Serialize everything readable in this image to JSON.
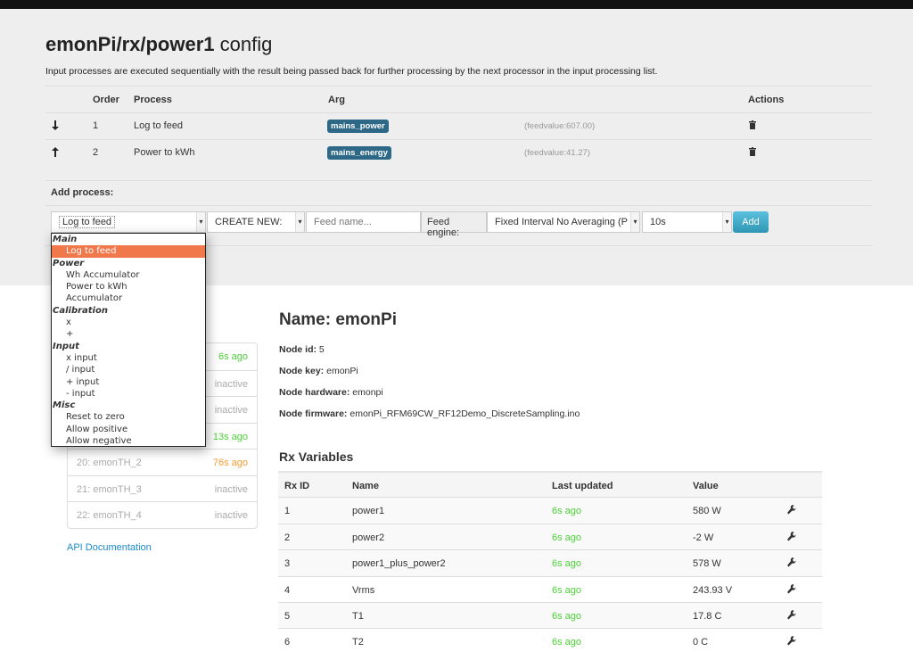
{
  "header": {
    "title_bold": "emonPi/rx/power1",
    "title_rest": " config",
    "description": "Input processes are executed sequentially with the result being passed back for further processing by the next processor in the input processing list."
  },
  "process_table": {
    "headers": {
      "order": "Order",
      "process": "Process",
      "arg": "Arg",
      "actions": "Actions"
    },
    "rows": [
      {
        "move_icon": "arrow-down-icon",
        "order": "1",
        "process": "Log to feed",
        "arg": "mains_power",
        "feedvalue": "(feedvalue:607.00)"
      },
      {
        "move_icon": "arrow-up-icon",
        "order": "2",
        "process": "Power to kWh",
        "arg": "mains_energy",
        "feedvalue": "(feedvalue:41.27)"
      }
    ]
  },
  "add_process": {
    "label": "Add process:",
    "process_select": "Log to feed",
    "create_select": "CREATE NEW:",
    "feed_name_placeholder": "Feed name...",
    "feed_engine_label": "Feed engine:",
    "feed_engine_select": "Fixed Interval No Averaging (P",
    "interval_select": "10s",
    "add_button": "Add"
  },
  "dropdown": {
    "groups": [
      {
        "label": "Main",
        "options": [
          "Log to feed"
        ]
      },
      {
        "label": "Power",
        "options": [
          "Wh Accumulator",
          "Power to kWh",
          "Accumulator"
        ]
      },
      {
        "label": "Calibration",
        "options": [
          "x",
          "+"
        ]
      },
      {
        "label": "Input",
        "options": [
          "x input",
          "/ input",
          "+ input",
          "- input"
        ]
      },
      {
        "label": "Misc",
        "options": [
          "Reset to zero",
          "Allow positive",
          "Allow negative"
        ]
      }
    ],
    "selected": "Log to feed"
  },
  "node_list": [
    {
      "name": "",
      "status": "6s ago",
      "state": "green"
    },
    {
      "name": "",
      "status": "inactive",
      "state": "gray"
    },
    {
      "name": "",
      "status": "inactive",
      "state": "gray"
    },
    {
      "name": "",
      "status": "13s ago",
      "state": "green"
    },
    {
      "name": "20: emonTH_2",
      "status": "76s ago",
      "state": "orange"
    },
    {
      "name": "21: emonTH_3",
      "status": "inactive",
      "state": "gray"
    },
    {
      "name": "22: emonTH_4",
      "status": "inactive",
      "state": "gray"
    }
  ],
  "api_link": "API Documentation",
  "node": {
    "name": "Name: emonPi",
    "id_label": "Node id:",
    "id": " 5",
    "key_label": "Node key:",
    "key": " emonPi",
    "hardware_label": "Node hardware:",
    "hardware": " emonpi",
    "firmware_label": "Node firmware:",
    "firmware": " emonPi_RFM69CW_RF12Demo_DiscreteSampling.ino"
  },
  "rx": {
    "title": "Rx Variables",
    "headers": {
      "id": "Rx ID",
      "name": "Name",
      "updated": "Last updated",
      "value": "Value"
    },
    "rows": [
      {
        "id": "1",
        "name": "power1",
        "updated": "6s ago",
        "value": "580 W"
      },
      {
        "id": "2",
        "name": "power2",
        "updated": "6s ago",
        "value": "-2 W"
      },
      {
        "id": "3",
        "name": "power1_plus_power2",
        "updated": "6s ago",
        "value": "578 W"
      },
      {
        "id": "4",
        "name": "Vrms",
        "updated": "6s ago",
        "value": "243.93 V"
      },
      {
        "id": "5",
        "name": "T1",
        "updated": "6s ago",
        "value": "17.8 C"
      },
      {
        "id": "6",
        "name": "T2",
        "updated": "6s ago",
        "value": "0 C"
      }
    ]
  },
  "colors": {
    "accent": "#2d6987",
    "highlight": "#f0784a",
    "active": "#4cd137",
    "warning": "#f39c34",
    "link": "#1a8ad0"
  }
}
